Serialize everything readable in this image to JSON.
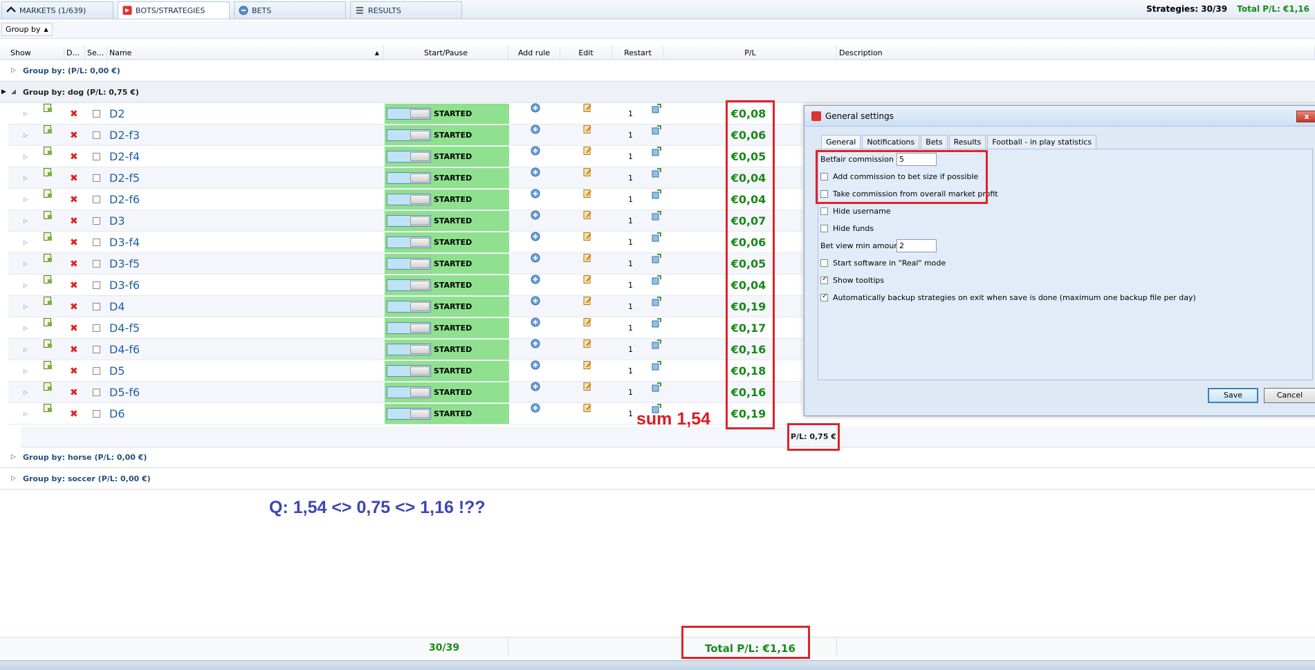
{
  "tabs": [
    {
      "label": "MARKETS (1/639)",
      "icon": "markets-icon"
    },
    {
      "label": "BOTS/STRATEGIES",
      "icon": "bots-icon"
    },
    {
      "label": "BETS",
      "icon": "bets-icon"
    },
    {
      "label": "RESULTS",
      "icon": "results-icon"
    }
  ],
  "topright": {
    "strategies": "Strategies: 30/39",
    "total_pl": "Total P/L: €1,16"
  },
  "toolbar": {
    "groupby_label": "Group by"
  },
  "columns": {
    "show": "Show",
    "d": "D...",
    "se": "Se...",
    "name": "Name",
    "start_pause": "Start/Pause",
    "add_rule": "Add rule",
    "edit": "Edit",
    "restart": "Restart",
    "pl": "P/L",
    "description": "Description"
  },
  "groups": [
    {
      "label": "Group by:  (P/L: 0,00 €)"
    },
    {
      "label": "Group by: dog (P/L: 0,75 €)"
    },
    {
      "label": "Group by: horse (P/L: 0,00 €)"
    },
    {
      "label": "Group by: soccer (P/L: 0,00 €)"
    }
  ],
  "rows": [
    {
      "name": "D2",
      "status": "STARTED",
      "restart": "1",
      "pl": "€0,08"
    },
    {
      "name": "D2-f3",
      "status": "STARTED",
      "restart": "1",
      "pl": "€0,06"
    },
    {
      "name": "D2-f4",
      "status": "STARTED",
      "restart": "1",
      "pl": "€0,05"
    },
    {
      "name": "D2-f5",
      "status": "STARTED",
      "restart": "1",
      "pl": "€0,04"
    },
    {
      "name": "D2-f6",
      "status": "STARTED",
      "restart": "1",
      "pl": "€0,04"
    },
    {
      "name": "D3",
      "status": "STARTED",
      "restart": "1",
      "pl": "€0,07"
    },
    {
      "name": "D3-f4",
      "status": "STARTED",
      "restart": "1",
      "pl": "€0,06"
    },
    {
      "name": "D3-f5",
      "status": "STARTED",
      "restart": "1",
      "pl": "€0,05"
    },
    {
      "name": "D3-f6",
      "status": "STARTED",
      "restart": "1",
      "pl": "€0,04"
    },
    {
      "name": "D4",
      "status": "STARTED",
      "restart": "1",
      "pl": "€0,19"
    },
    {
      "name": "D4-f5",
      "status": "STARTED",
      "restart": "1",
      "pl": "€0,17"
    },
    {
      "name": "D4-f6",
      "status": "STARTED",
      "restart": "1",
      "pl": "€0,16"
    },
    {
      "name": "D5",
      "status": "STARTED",
      "restart": "1",
      "pl": "€0,18"
    },
    {
      "name": "D5-f6",
      "status": "STARTED",
      "restart": "1",
      "pl": "€0,16"
    },
    {
      "name": "D6",
      "status": "STARTED",
      "restart": "1",
      "pl": "€0,19"
    }
  ],
  "group_summary": {
    "pl": "P/L: 0,75 €"
  },
  "annotations": {
    "sum": "sum 1,54",
    "question": "Q: 1,54 <> 0,75 <> 1,16 !??"
  },
  "dialog": {
    "title": "General settings",
    "close": "x",
    "tabs": [
      "General",
      "Notifications",
      "Bets",
      "Results",
      "Football - in play statistics"
    ],
    "betfair_commission_label": "Betfair commission",
    "betfair_commission_value": "5",
    "add_commission_label": "Add commission to bet size if possible",
    "take_commission_label": "Take commission from overall market profit",
    "hide_username_label": "Hide username",
    "hide_funds_label": "Hide funds",
    "bet_view_min_label": "Bet view min amount",
    "bet_view_min_value": "2",
    "start_real_label": "Start software in \"Real\" mode",
    "show_tooltips_label": "Show tooltips",
    "auto_backup_label": "Automatically backup strategies on exit when save is done (maximum one backup file per day)",
    "save_label": "Save",
    "cancel_label": "Cancel"
  },
  "footer": {
    "count": "30/39",
    "total": "Total P/L: €1,16"
  },
  "colors": {
    "accent_green": "#178a17",
    "started_bg": "#8fe08f",
    "annotation_red": "#e0222b",
    "annotation_blue": "#3a45b7"
  }
}
